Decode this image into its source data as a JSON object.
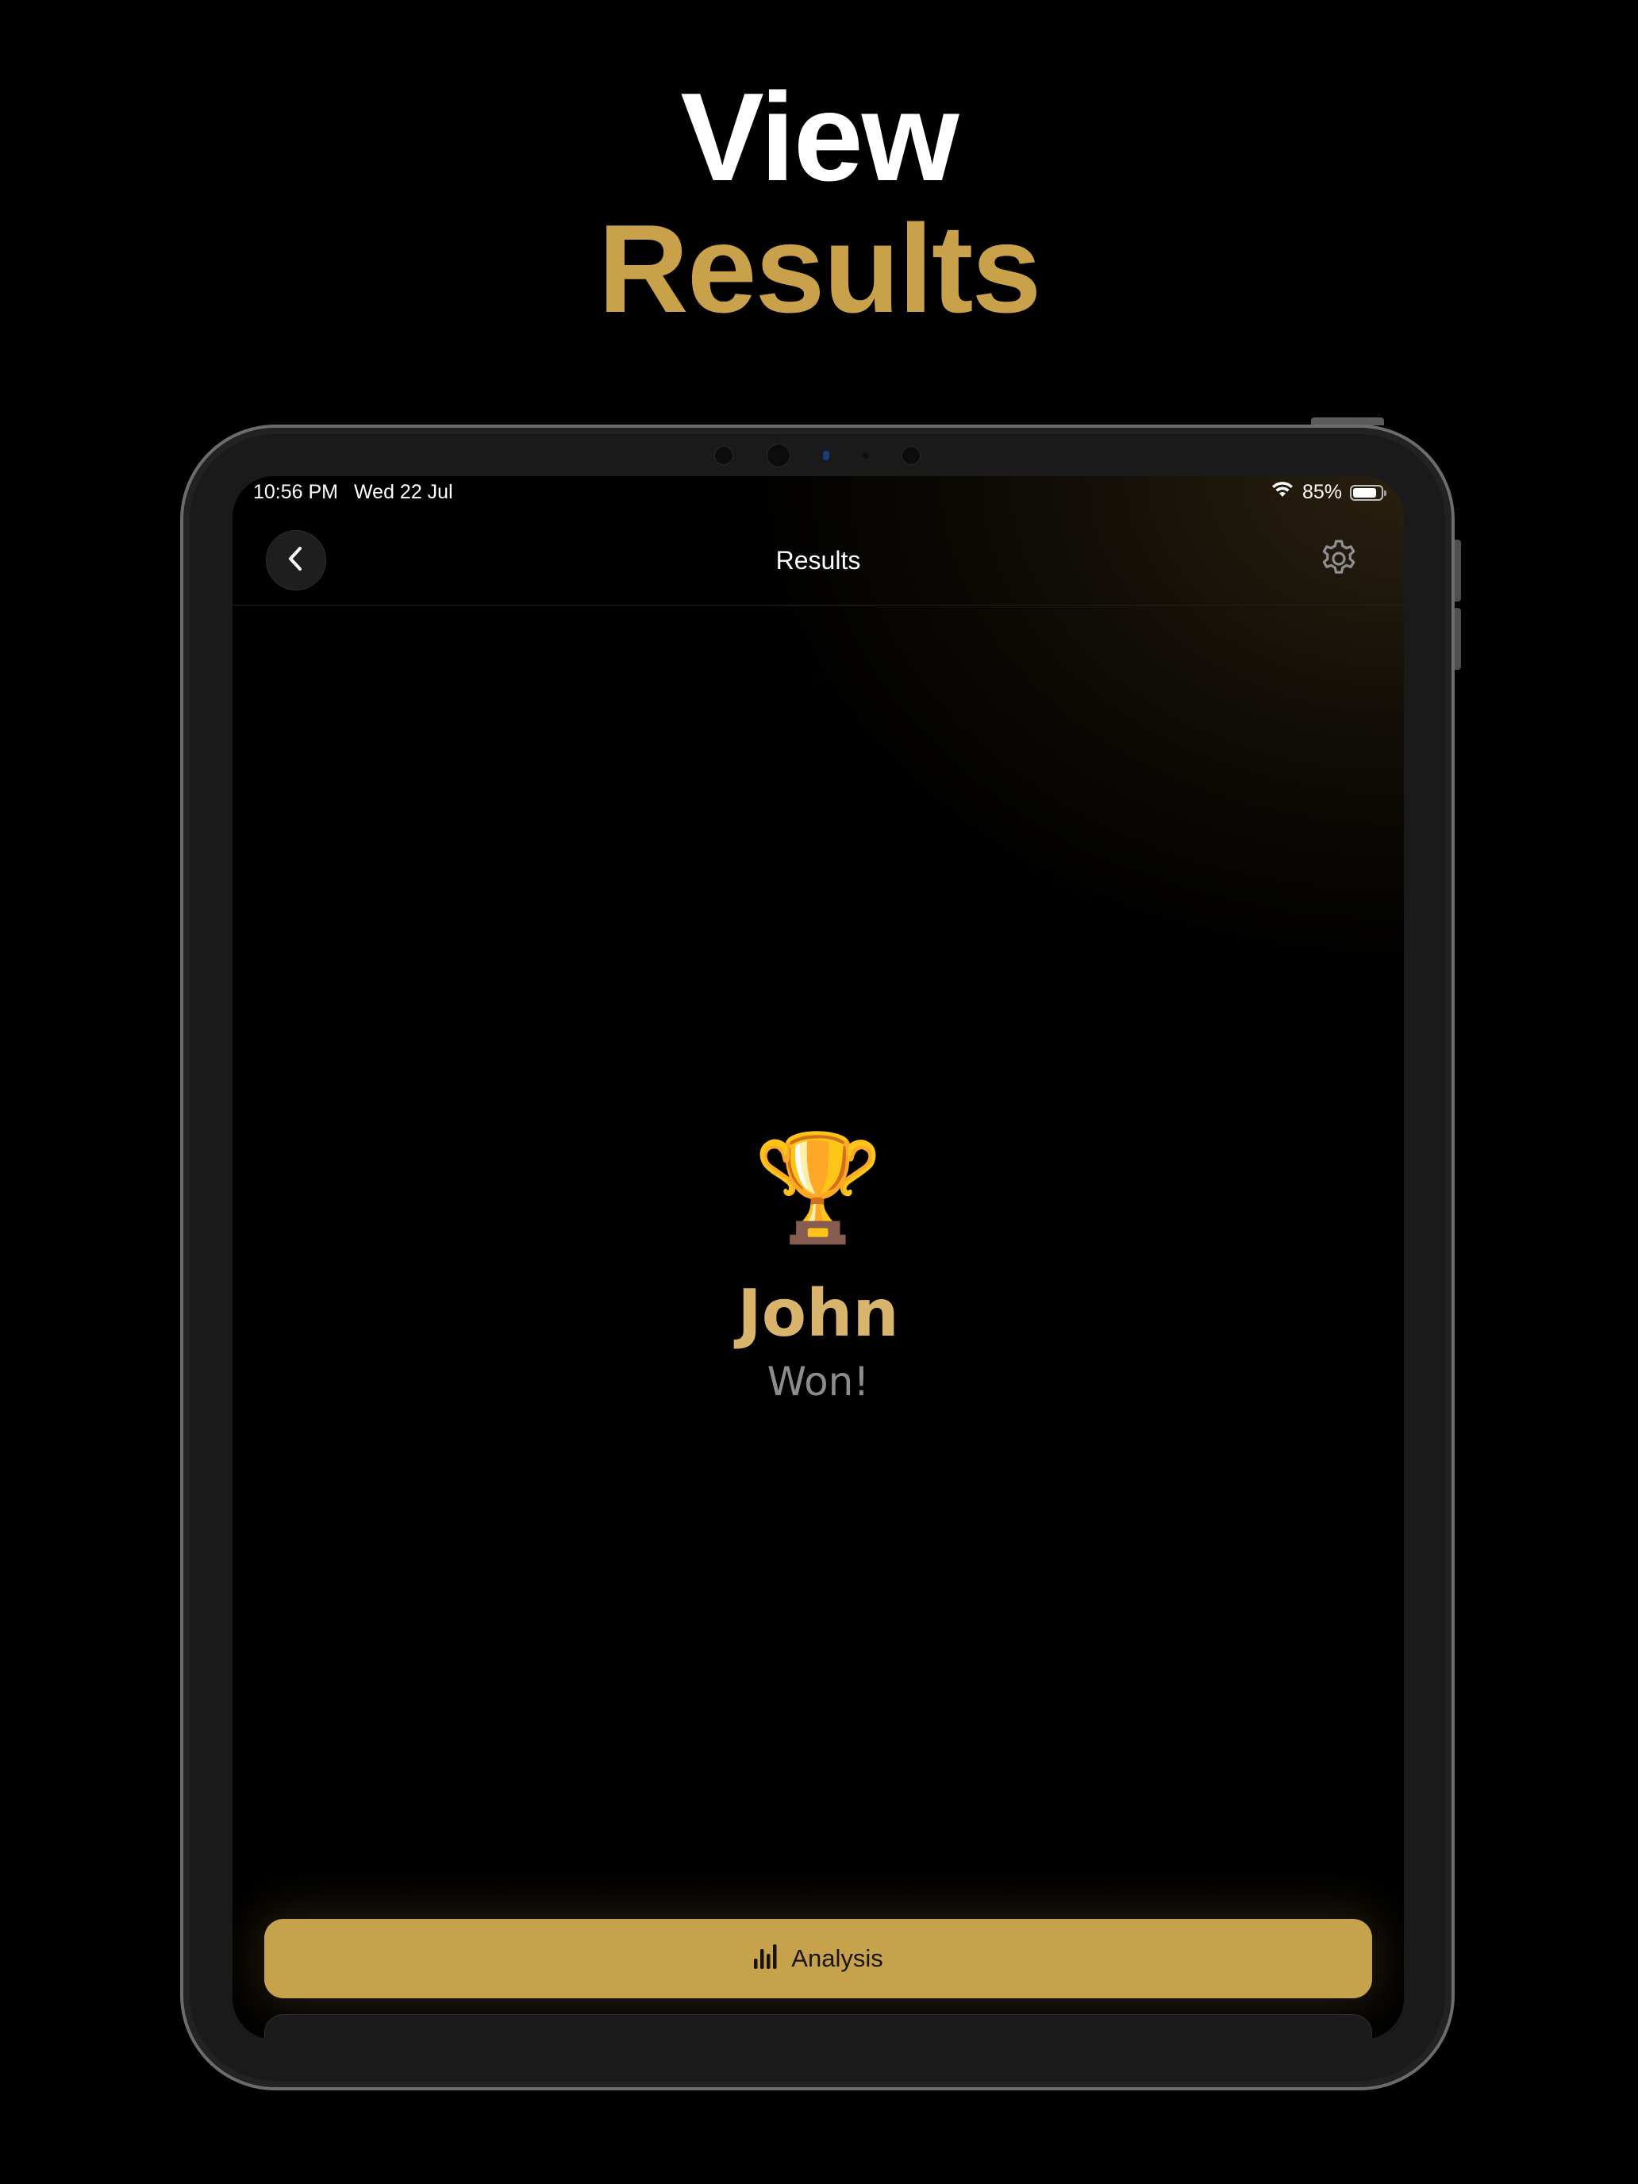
{
  "headline": {
    "line1": "View",
    "line2": "Results"
  },
  "status_bar": {
    "time": "10:56 PM",
    "date": "Wed 22 Jul",
    "battery_percent": "85%",
    "battery_level": 0.85,
    "wifi_icon": "wifi-icon",
    "battery_icon": "battery-icon"
  },
  "navbar": {
    "title": "Results",
    "back_icon": "chevron-left-icon",
    "settings_icon": "gear-icon"
  },
  "result": {
    "icon": "🏆",
    "icon_name": "trophy-icon",
    "winner_name": "John",
    "status": "Won!"
  },
  "actions": {
    "analysis_label": "Analysis",
    "analysis_icon": "bar-chart-icon"
  },
  "colors": {
    "accent": "#c9a14a",
    "winner_name": "#d8b46c",
    "background": "#000000"
  }
}
